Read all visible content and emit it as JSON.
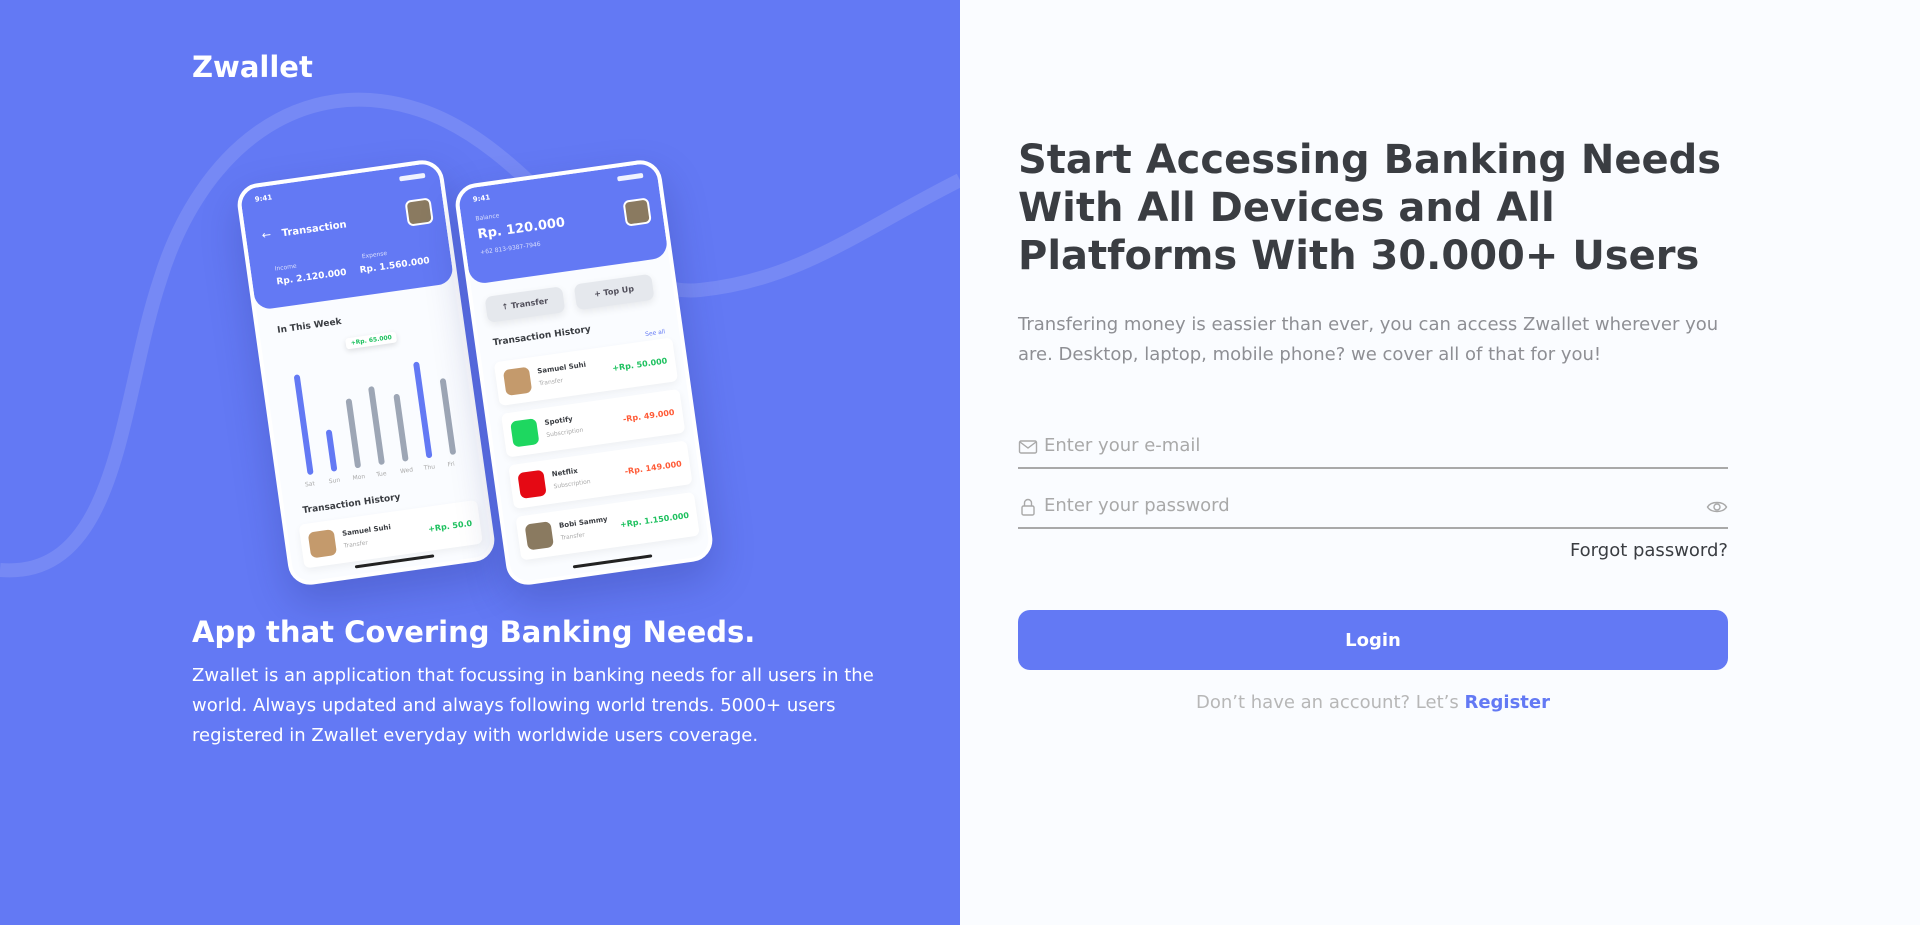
{
  "brand": "Zwallet",
  "hero": {
    "title": "App that Covering Banking Needs.",
    "description": "Zwallet is an application that focussing in banking needs for all users in the world. Always updated and always following world trends. 5000+ users registered in Zwallet everyday with worldwide users coverage."
  },
  "phone1": {
    "time": "9:41",
    "title": "Transaction",
    "income_label": "Income",
    "income_amount": "Rp. 2.120.000",
    "expense_label": "Expense",
    "expense_amount": "Rp. 1.560.000",
    "week_label": "In This Week",
    "tooltip": "+Rp. 65.000",
    "days": [
      "Sat",
      "Sun",
      "Mon",
      "Tue",
      "Wed",
      "Thu",
      "Fri"
    ],
    "history_label": "Transaction History",
    "history_name": "Samuel Suhi",
    "history_type": "Transfer",
    "history_amount": "+Rp. 50.0"
  },
  "phone2": {
    "time": "9:41",
    "balance_label": "Balance",
    "balance": "Rp. 120.000",
    "phone_number": "+62 813-9387-7946",
    "transfer_label": "Transfer",
    "topup_label": "Top Up",
    "history_label": "Transaction History",
    "see_all": "See all",
    "history": [
      {
        "name": "Samuel Suhi",
        "type": "Transfer",
        "amount": "+Rp. 50.000",
        "sign": "pos",
        "color": "#c49a6c"
      },
      {
        "name": "Spotify",
        "type": "Subscription",
        "amount": "-Rp. 49.000",
        "sign": "neg",
        "color": "#1ed760"
      },
      {
        "name": "Netflix",
        "type": "Subscription",
        "amount": "-Rp. 149.000",
        "sign": "neg",
        "color": "#e50914"
      },
      {
        "name": "Bobi Sammy",
        "type": "Transfer",
        "amount": "+Rp. 1.150.000",
        "sign": "pos",
        "color": "#8a7a60"
      }
    ]
  },
  "chart_values": [
    0.92,
    0.38,
    0.64,
    0.72,
    0.62,
    0.88,
    0.7
  ],
  "chart_colors": [
    "blue",
    "blue",
    "grey",
    "grey",
    "grey",
    "blue",
    "grey"
  ],
  "login": {
    "heading": "Start Accessing Banking Needs With All Devices and All Platforms With 30.000+ Users",
    "subtext": "Transfering money is eassier than ever, you can access Zwallet wherever you are. Desktop, laptop, mobile phone? we cover all of that for you!",
    "email_placeholder": "Enter your e-mail",
    "password_placeholder": "Enter your password",
    "forgot": "Forgot password?",
    "button": "Login",
    "register_prompt": "Don’t have an account? Let’s ",
    "register_link": "Register"
  },
  "colors": {
    "primary": "#6379f4",
    "positive": "#1ec15f",
    "negative": "#ff5b37",
    "text_dark": "#3a3d42"
  }
}
